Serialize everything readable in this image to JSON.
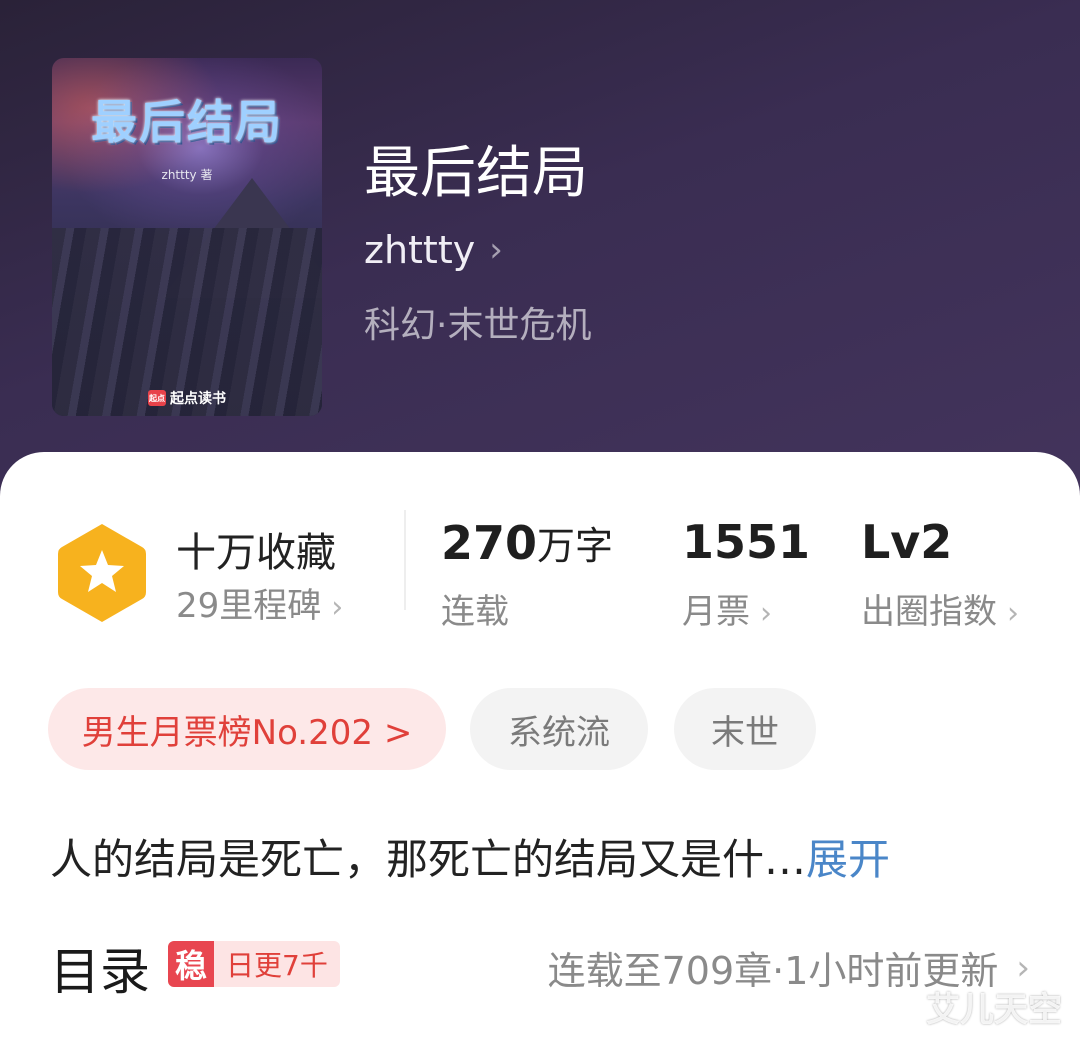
{
  "book": {
    "cover_title": "最后结局",
    "cover_author": "zhttty 著",
    "cover_publisher": "起点读书",
    "cover_publisher_logo": "起点",
    "title": "最后结局",
    "author": "zhttty",
    "genre": "科幻·末世危机"
  },
  "stats": {
    "collection": {
      "main": "十万收藏",
      "sub": "29里程碑"
    },
    "words": {
      "number": "270",
      "unit": "万字",
      "label": "连载"
    },
    "votes": {
      "number": "1551",
      "label": "月票"
    },
    "level": {
      "number": "Lv2",
      "label": "出圈指数"
    }
  },
  "tags": {
    "rank": "男生月票榜No.202 >",
    "items": [
      "系统流",
      "末世"
    ]
  },
  "synopsis": {
    "text": "人的结局是死亡，那死亡的结局又是什…",
    "expand": "展开"
  },
  "toc": {
    "title": "目录",
    "badge_mark": "稳",
    "badge_text": "日更7千",
    "update": "连载至709章·1小时前更新"
  },
  "watermark": "艾儿天空",
  "colors": {
    "header_bg": "#3a2d52",
    "accent_red": "#e0403a",
    "link_blue": "#4a86c8",
    "badge_gold": "#f7b21e"
  }
}
